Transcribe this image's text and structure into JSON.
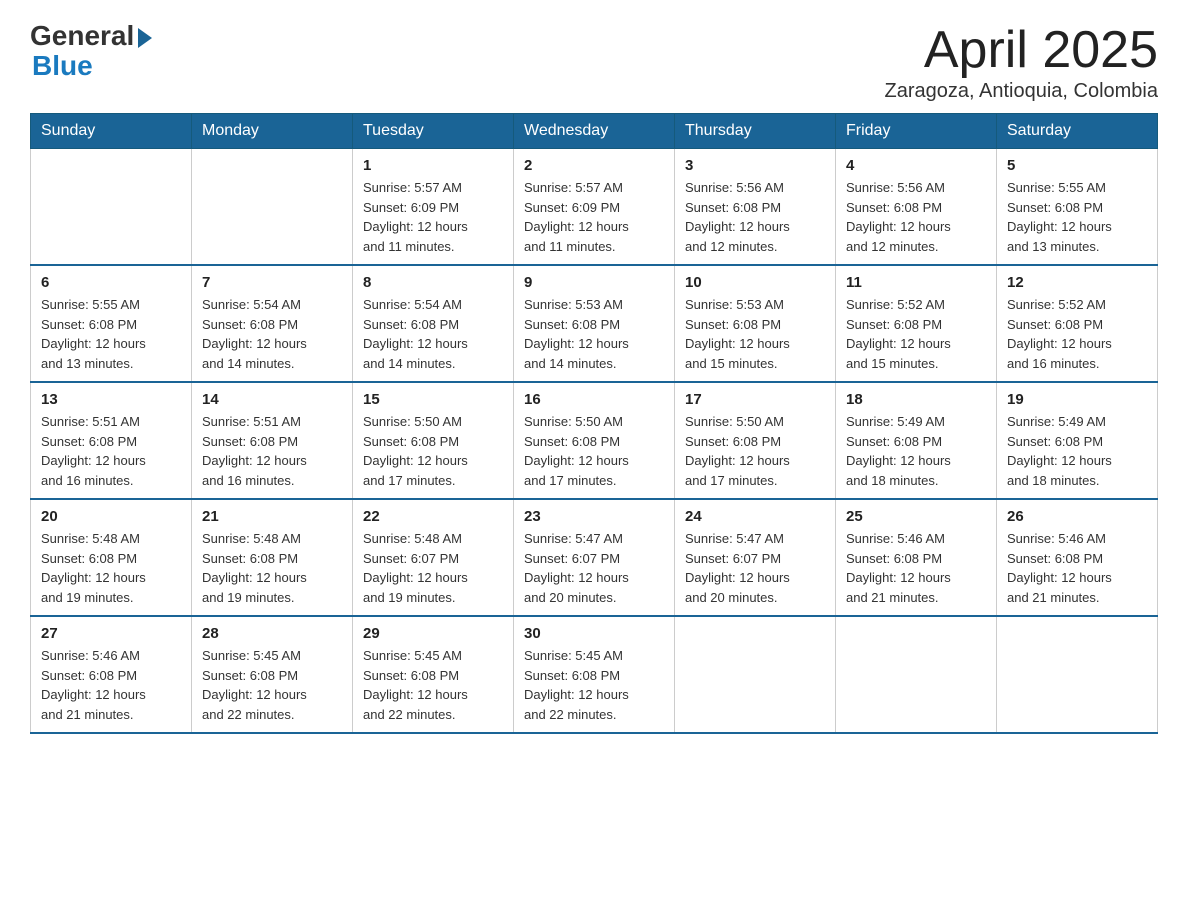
{
  "header": {
    "logo_general": "General",
    "logo_blue": "Blue",
    "month_title": "April 2025",
    "location": "Zaragoza, Antioquia, Colombia"
  },
  "columns": [
    "Sunday",
    "Monday",
    "Tuesday",
    "Wednesday",
    "Thursday",
    "Friday",
    "Saturday"
  ],
  "weeks": [
    [
      {
        "day": "",
        "info": ""
      },
      {
        "day": "",
        "info": ""
      },
      {
        "day": "1",
        "info": "Sunrise: 5:57 AM\nSunset: 6:09 PM\nDaylight: 12 hours\nand 11 minutes."
      },
      {
        "day": "2",
        "info": "Sunrise: 5:57 AM\nSunset: 6:09 PM\nDaylight: 12 hours\nand 11 minutes."
      },
      {
        "day": "3",
        "info": "Sunrise: 5:56 AM\nSunset: 6:08 PM\nDaylight: 12 hours\nand 12 minutes."
      },
      {
        "day": "4",
        "info": "Sunrise: 5:56 AM\nSunset: 6:08 PM\nDaylight: 12 hours\nand 12 minutes."
      },
      {
        "day": "5",
        "info": "Sunrise: 5:55 AM\nSunset: 6:08 PM\nDaylight: 12 hours\nand 13 minutes."
      }
    ],
    [
      {
        "day": "6",
        "info": "Sunrise: 5:55 AM\nSunset: 6:08 PM\nDaylight: 12 hours\nand 13 minutes."
      },
      {
        "day": "7",
        "info": "Sunrise: 5:54 AM\nSunset: 6:08 PM\nDaylight: 12 hours\nand 14 minutes."
      },
      {
        "day": "8",
        "info": "Sunrise: 5:54 AM\nSunset: 6:08 PM\nDaylight: 12 hours\nand 14 minutes."
      },
      {
        "day": "9",
        "info": "Sunrise: 5:53 AM\nSunset: 6:08 PM\nDaylight: 12 hours\nand 14 minutes."
      },
      {
        "day": "10",
        "info": "Sunrise: 5:53 AM\nSunset: 6:08 PM\nDaylight: 12 hours\nand 15 minutes."
      },
      {
        "day": "11",
        "info": "Sunrise: 5:52 AM\nSunset: 6:08 PM\nDaylight: 12 hours\nand 15 minutes."
      },
      {
        "day": "12",
        "info": "Sunrise: 5:52 AM\nSunset: 6:08 PM\nDaylight: 12 hours\nand 16 minutes."
      }
    ],
    [
      {
        "day": "13",
        "info": "Sunrise: 5:51 AM\nSunset: 6:08 PM\nDaylight: 12 hours\nand 16 minutes."
      },
      {
        "day": "14",
        "info": "Sunrise: 5:51 AM\nSunset: 6:08 PM\nDaylight: 12 hours\nand 16 minutes."
      },
      {
        "day": "15",
        "info": "Sunrise: 5:50 AM\nSunset: 6:08 PM\nDaylight: 12 hours\nand 17 minutes."
      },
      {
        "day": "16",
        "info": "Sunrise: 5:50 AM\nSunset: 6:08 PM\nDaylight: 12 hours\nand 17 minutes."
      },
      {
        "day": "17",
        "info": "Sunrise: 5:50 AM\nSunset: 6:08 PM\nDaylight: 12 hours\nand 17 minutes."
      },
      {
        "day": "18",
        "info": "Sunrise: 5:49 AM\nSunset: 6:08 PM\nDaylight: 12 hours\nand 18 minutes."
      },
      {
        "day": "19",
        "info": "Sunrise: 5:49 AM\nSunset: 6:08 PM\nDaylight: 12 hours\nand 18 minutes."
      }
    ],
    [
      {
        "day": "20",
        "info": "Sunrise: 5:48 AM\nSunset: 6:08 PM\nDaylight: 12 hours\nand 19 minutes."
      },
      {
        "day": "21",
        "info": "Sunrise: 5:48 AM\nSunset: 6:08 PM\nDaylight: 12 hours\nand 19 minutes."
      },
      {
        "day": "22",
        "info": "Sunrise: 5:48 AM\nSunset: 6:07 PM\nDaylight: 12 hours\nand 19 minutes."
      },
      {
        "day": "23",
        "info": "Sunrise: 5:47 AM\nSunset: 6:07 PM\nDaylight: 12 hours\nand 20 minutes."
      },
      {
        "day": "24",
        "info": "Sunrise: 5:47 AM\nSunset: 6:07 PM\nDaylight: 12 hours\nand 20 minutes."
      },
      {
        "day": "25",
        "info": "Sunrise: 5:46 AM\nSunset: 6:08 PM\nDaylight: 12 hours\nand 21 minutes."
      },
      {
        "day": "26",
        "info": "Sunrise: 5:46 AM\nSunset: 6:08 PM\nDaylight: 12 hours\nand 21 minutes."
      }
    ],
    [
      {
        "day": "27",
        "info": "Sunrise: 5:46 AM\nSunset: 6:08 PM\nDaylight: 12 hours\nand 21 minutes."
      },
      {
        "day": "28",
        "info": "Sunrise: 5:45 AM\nSunset: 6:08 PM\nDaylight: 12 hours\nand 22 minutes."
      },
      {
        "day": "29",
        "info": "Sunrise: 5:45 AM\nSunset: 6:08 PM\nDaylight: 12 hours\nand 22 minutes."
      },
      {
        "day": "30",
        "info": "Sunrise: 5:45 AM\nSunset: 6:08 PM\nDaylight: 12 hours\nand 22 minutes."
      },
      {
        "day": "",
        "info": ""
      },
      {
        "day": "",
        "info": ""
      },
      {
        "day": "",
        "info": ""
      }
    ]
  ]
}
